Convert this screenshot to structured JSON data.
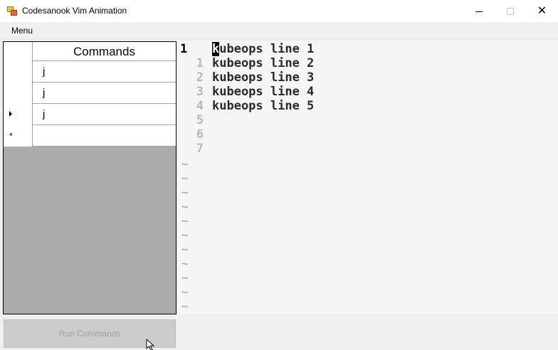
{
  "window": {
    "title": "Codesanook Vim Animation",
    "minimize_label": "",
    "maximize_label": "",
    "close_label": "✕"
  },
  "menu": {
    "items": [
      "Menu"
    ]
  },
  "commands_grid": {
    "column_header": "Commands",
    "rows": [
      {
        "value": "j",
        "marker": ""
      },
      {
        "value": "j",
        "marker": ""
      },
      {
        "value": "j",
        "marker": "current"
      },
      {
        "value": "",
        "marker": "new"
      }
    ],
    "new_row_marker": "*"
  },
  "run_button": {
    "label": "Run Commands",
    "enabled": false
  },
  "editor": {
    "current_line_number": "1",
    "cursor_char": "k",
    "lines": [
      {
        "num": "1",
        "text": "kubeops line 1"
      },
      {
        "num": "1",
        "text": "kubeops line 2"
      },
      {
        "num": "2",
        "text": "kubeops line 3"
      },
      {
        "num": "3",
        "text": "kubeops line 4"
      },
      {
        "num": "4",
        "text": "kubeops line 5"
      },
      {
        "num": "5",
        "text": ""
      },
      {
        "num": "6",
        "text": ""
      },
      {
        "num": "7",
        "text": ""
      }
    ],
    "tilde": "~",
    "tilde_count": 11
  },
  "colors": {
    "grid_background": "#ababab",
    "editor_background": "#f5f5f5",
    "cursor_block": "#000000"
  }
}
